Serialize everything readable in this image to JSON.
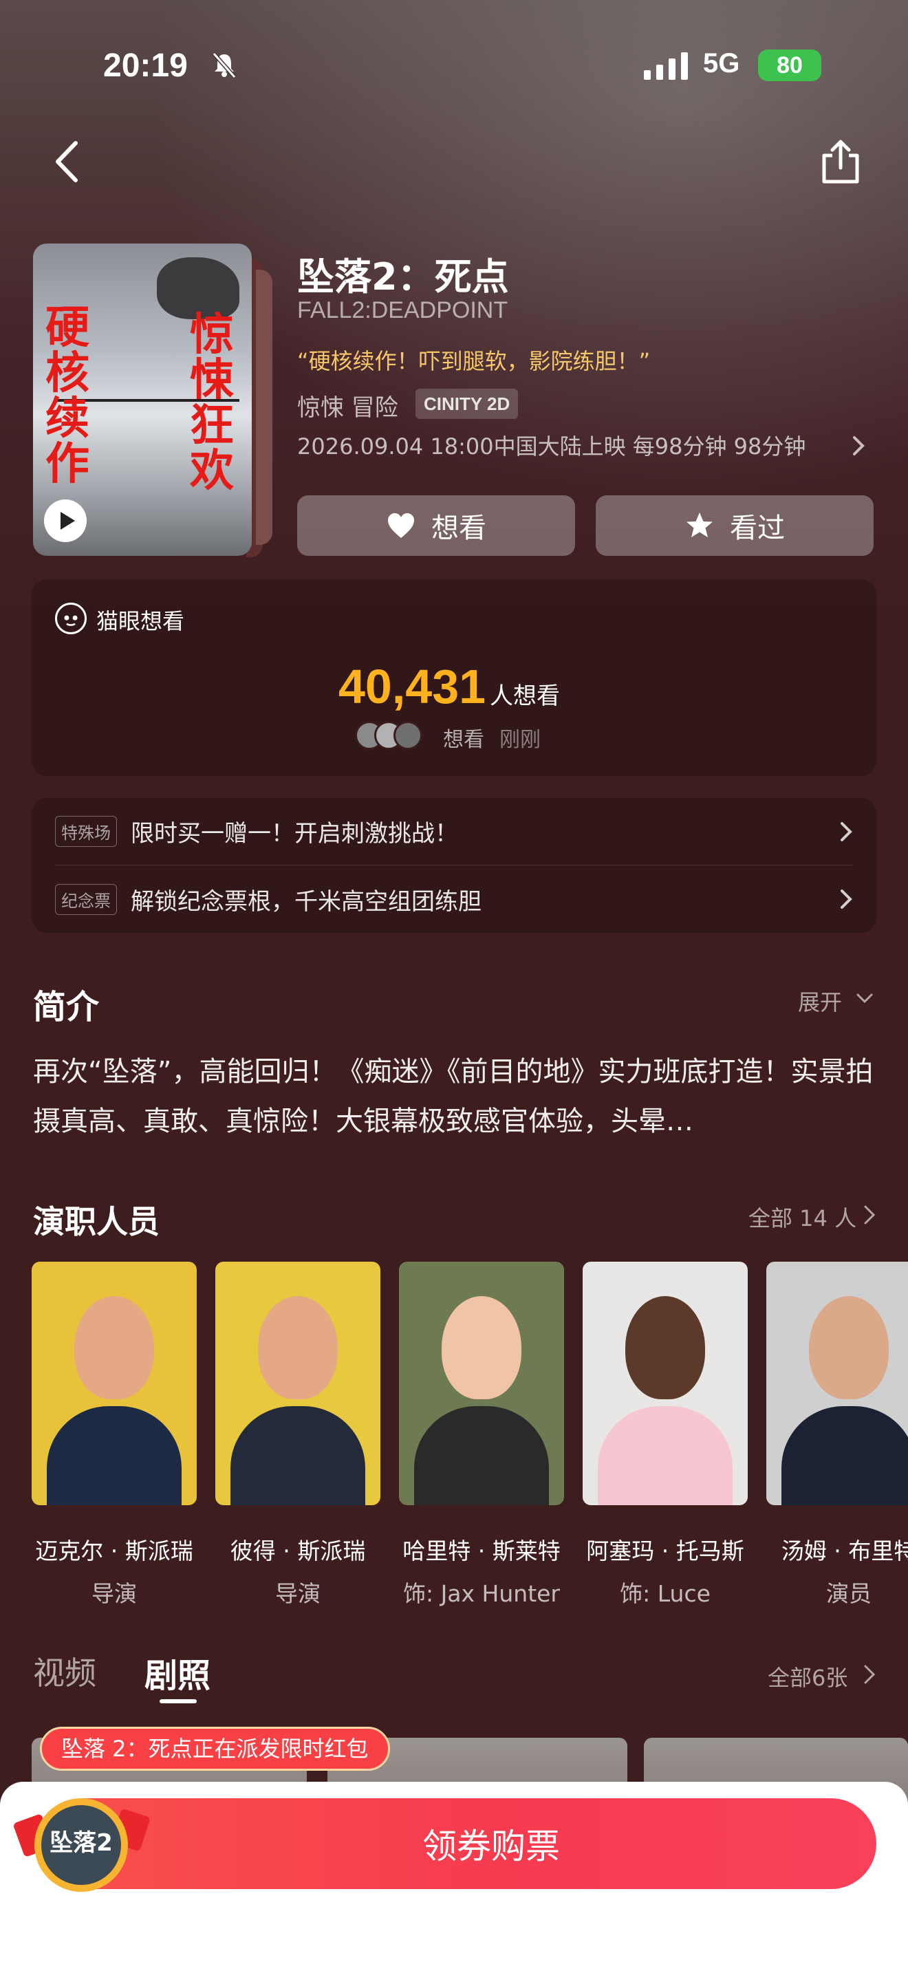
{
  "status_bar": {
    "time": "20:19",
    "network": "5G",
    "battery": "80"
  },
  "colors": {
    "accent": "#ffb21e",
    "buy_button": "#f63b4f",
    "background": "#3e1d1f"
  },
  "movie": {
    "title": "坠落2：死点",
    "title_en": "FALL2:DEADPOINT",
    "tagline": "“硬核续作！吓到腿软，影院练胆！”",
    "genres": "惊悚 冒险",
    "format_badge": "CINITY 2D",
    "release_info": "2026.09.04 18:00中国大陆上映 每98分钟 98分钟",
    "poster_text_left": "硬核续作",
    "poster_text_right": "惊悚狂欢"
  },
  "actions": {
    "want_label": "想看",
    "seen_label": "看过"
  },
  "want_card": {
    "brand_label": "猫眼想看",
    "count": "40,431",
    "count_unit": "人想看",
    "recent_label": "想看",
    "recent_time": "刚刚"
  },
  "promos": [
    {
      "tag": "特殊场",
      "text": "限时买一赠一！开启刺激挑战！"
    },
    {
      "tag": "纪念票",
      "text": "解锁纪念票根，千米高空组团练胆"
    }
  ],
  "intro": {
    "title": "简介",
    "expand_label": "展开",
    "text": "再次“坠落”，高能回归！《痴迷》《前目的地》实力班底打造！实景拍摄真高、真敢、真惊险！大银幕极致感官体验，头晕…"
  },
  "cast": {
    "title": "演职人员",
    "all_label": "全部 14 人",
    "members": [
      {
        "name": "迈克尔 · 斯派瑞",
        "role": "导演"
      },
      {
        "name": "彼得 · 斯派瑞",
        "role": "导演"
      },
      {
        "name": "哈里特 · 斯莱特",
        "role": "饰: Jax Hunter"
      },
      {
        "name": "阿塞玛 · 托马斯",
        "role": "饰: Luce"
      },
      {
        "name": "汤姆 · 布里特",
        "role": "演员"
      }
    ]
  },
  "media": {
    "tab_video": "视频",
    "tab_stills": "剧照",
    "all_label": "全部6张"
  },
  "bottom": {
    "redpack_tip": "坠落 2：死点正在派发限时红包",
    "buy_label": "领券购票"
  }
}
